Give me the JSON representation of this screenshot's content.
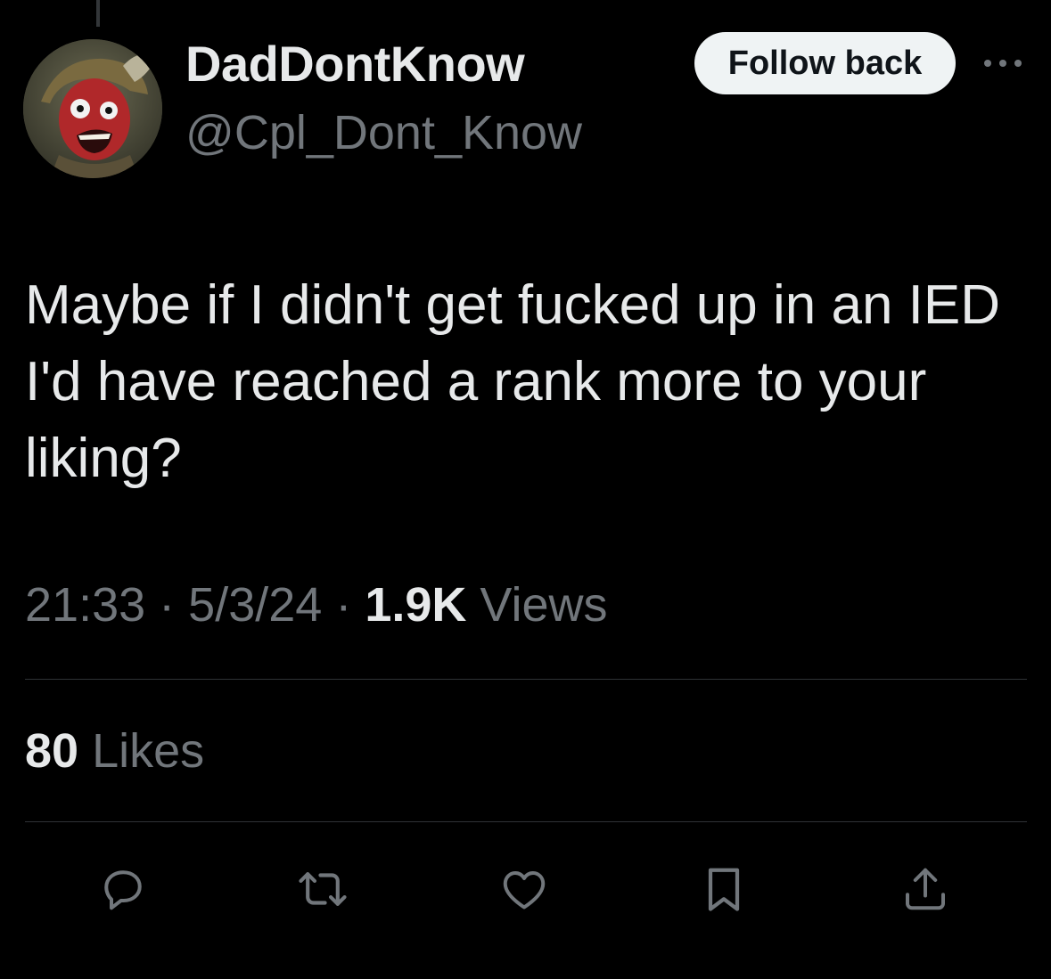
{
  "tweet": {
    "display_name": "DadDontKnow",
    "handle": "@Cpl_Dont_Know",
    "follow_label": "Follow back",
    "text": "Maybe if I didn't get fucked up in an IED I'd have reached a rank more to your liking?",
    "time": "21:33",
    "date": "5/3/24",
    "separator": "·",
    "views_count": "1.9K",
    "views_label": "Views",
    "likes_count": "80",
    "likes_label": "Likes"
  },
  "icons": {
    "more": "more-horizontal-icon",
    "reply": "reply-icon",
    "retweet": "retweet-icon",
    "like": "heart-icon",
    "bookmark": "bookmark-icon",
    "share": "share-icon"
  },
  "colors": {
    "background": "#000000",
    "primary_text": "#e7e9ea",
    "secondary_text": "#71767b",
    "button_bg": "#eff3f4",
    "divider": "#2f3336"
  }
}
